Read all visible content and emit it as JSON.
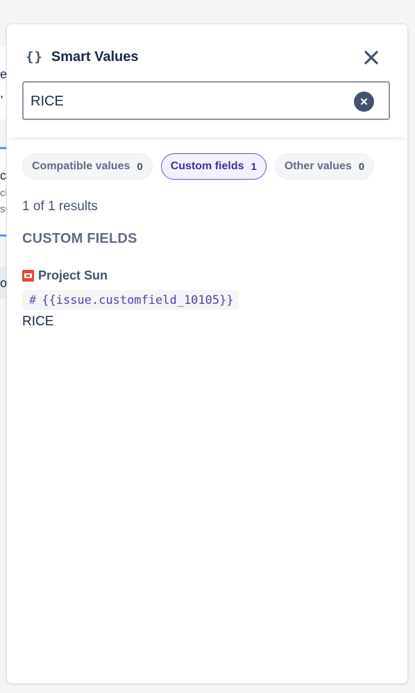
{
  "panel": {
    "title": "Smart Values",
    "braces_glyph": "{}",
    "close_icon": "close-icon"
  },
  "search": {
    "value": "RICE",
    "placeholder": "",
    "clear_icon": "clear-icon"
  },
  "filters": [
    {
      "label": "Compatible values",
      "count": "0",
      "active": false
    },
    {
      "label": "Custom fields",
      "count": "1",
      "active": true
    },
    {
      "label": "Other values",
      "count": "0",
      "active": false
    }
  ],
  "results": {
    "summary": "1 of 1 results",
    "section_title": "CUSTOM FIELDS",
    "items": [
      {
        "project_name": "Project Sun",
        "project_icon": "project-avatar-icon",
        "smart_value": "{{issue.customfield_10105}}",
        "type_glyph": "#",
        "field_name": "RICE"
      }
    ]
  },
  "background_fragments": [
    "er",
    ",",
    "c",
    "cl",
    "su",
    "o"
  ],
  "colors": {
    "accent": "#6554c0",
    "accent_text": "#403294",
    "text": "#172b4d",
    "subtle_text": "#5e6c84",
    "project_icon": "#e34935"
  }
}
